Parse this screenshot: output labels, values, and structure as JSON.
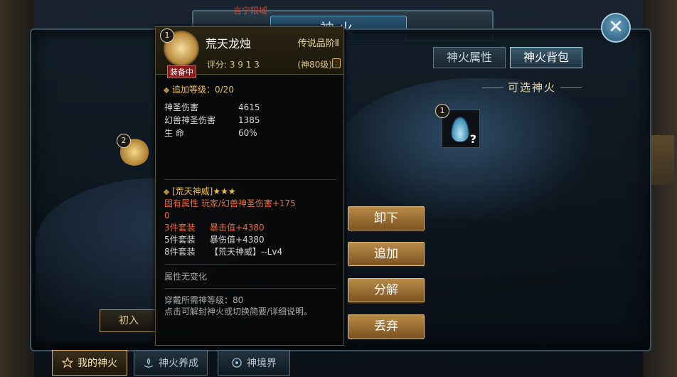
{
  "window": {
    "title": "神火",
    "top_red_text": "言宁眼域"
  },
  "tabs": [
    {
      "label": "神火属性",
      "active": false
    },
    {
      "label": "神火背包",
      "active": true
    }
  ],
  "selectable": {
    "title": "可选神火",
    "slot_badge": "1",
    "slot_icon": "blue-flame-icon"
  },
  "scene": {
    "small_badge": "2",
    "deco_label": "初入"
  },
  "tooltip": {
    "badge": "1",
    "name": "荒天龙烛",
    "grade": "传说品阶Ⅱ",
    "equipped": "装备中",
    "score": "评分: 3 9 1 3",
    "level": "(神80级)",
    "extra_level": "追加等级：0/20",
    "stats": [
      {
        "label": "神圣伤害",
        "value": "4615"
      },
      {
        "label": "幻兽神圣伤害",
        "value": "1385"
      },
      {
        "label": "生    命",
        "value": "60%"
      }
    ],
    "set_title": "[荒天神威]★★★",
    "inherent_line1": "固有属性      玩家/幻兽神圣伤害+175",
    "inherent_line2": "0",
    "set_bonuses": [
      {
        "label": "3件套装",
        "value": "暴击值+4380",
        "color": "#e86b3f"
      },
      {
        "label": "5件套装",
        "value": "暴伤值+4380",
        "color": "#d6d6d6"
      },
      {
        "label": "8件套装",
        "value": "【荒天神威】--Lv4",
        "color": "#d6d6d6"
      }
    ],
    "no_change": "属性无变化",
    "requirement": "穿戴所需神等级：80",
    "hint": "点击可解封神火或切换简要/详细说明。"
  },
  "actions": [
    {
      "label": "卸下"
    },
    {
      "label": "追加"
    },
    {
      "label": "分解"
    },
    {
      "label": "丢弃"
    }
  ],
  "bottom_nav": [
    {
      "label": "我的神火",
      "active": true
    },
    {
      "label": "神火养成",
      "active": false
    },
    {
      "label": "神境界",
      "active": false
    }
  ],
  "colors": {
    "gold": "#f1c14d",
    "red_text": "#e86b3f",
    "button": "#b98b4a",
    "frame_border": "#3a5363"
  }
}
